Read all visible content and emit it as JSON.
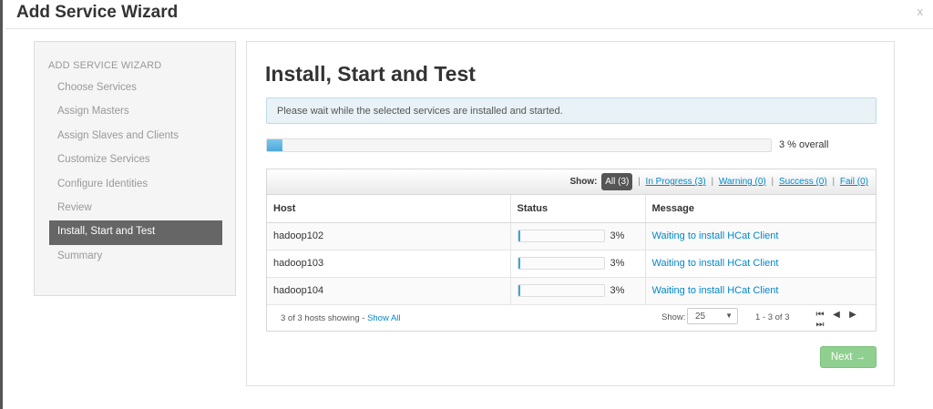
{
  "window": {
    "title": "Add Service Wizard",
    "close_label": "x"
  },
  "sidebar": {
    "heading": "ADD SERVICE WIZARD",
    "items": [
      {
        "label": "Choose Services",
        "active": false
      },
      {
        "label": "Assign Masters",
        "active": false
      },
      {
        "label": "Assign Slaves and Clients",
        "active": false
      },
      {
        "label": "Customize Services",
        "active": false
      },
      {
        "label": "Configure Identities",
        "active": false
      },
      {
        "label": "Review",
        "active": false
      },
      {
        "label": "Install, Start and Test",
        "active": true
      },
      {
        "label": "Summary",
        "active": false
      }
    ]
  },
  "main": {
    "title": "Install, Start and Test",
    "info": "Please wait while the selected services are installed and started.",
    "overall_progress": 3,
    "overall_label": "3 % overall"
  },
  "filters": {
    "show_label": "Show:",
    "all": "All (3)",
    "in_progress": "In Progress (3)",
    "warning": "Warning (0)",
    "success": "Success (0)",
    "fail": "Fail (0)",
    "separator": "|"
  },
  "table": {
    "columns": [
      "Host",
      "Status",
      "Message"
    ],
    "rows": [
      {
        "host": "hadoop102",
        "progress": 3,
        "pct": "3%",
        "message": "Waiting to install HCat Client"
      },
      {
        "host": "hadoop103",
        "progress": 3,
        "pct": "3%",
        "message": "Waiting to install HCat Client"
      },
      {
        "host": "hadoop104",
        "progress": 3,
        "pct": "3%",
        "message": "Waiting to install HCat Client"
      }
    ]
  },
  "footer": {
    "hosts_showing": "3 of 3 hosts showing - ",
    "show_all": "Show All",
    "show_label": "Show:",
    "page_size": "25",
    "range": "1 - 3 of 3"
  },
  "buttons": {
    "next": "Next →"
  },
  "colors": {
    "accent": "#0088cc",
    "active_nav": "#666666",
    "progress": "#3aa6dd",
    "next_button": "#8fcf8f"
  },
  "icons": {
    "first": "first-page-icon",
    "prev": "prev-page-icon",
    "next": "next-page-icon",
    "last": "last-page-icon"
  }
}
